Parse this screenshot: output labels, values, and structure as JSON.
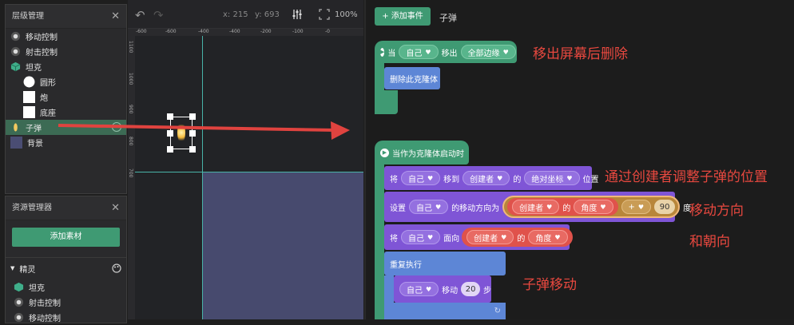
{
  "layer_panel": {
    "title": "层级管理",
    "close": "✕",
    "items": [
      {
        "label": "移动控制"
      },
      {
        "label": "射击控制"
      },
      {
        "label": "坦克"
      },
      {
        "label": "圆形"
      },
      {
        "label": "炮"
      },
      {
        "label": "底座"
      },
      {
        "label": "子弹"
      },
      {
        "label": "背景"
      }
    ]
  },
  "asset_panel": {
    "title": "资源管理器",
    "close": "✕",
    "add_label": "添加素材",
    "section": "精灵",
    "items": [
      {
        "label": "坦克"
      },
      {
        "label": "射击控制"
      },
      {
        "label": "移动控制"
      }
    ]
  },
  "toolbar": {
    "x_label": "x: 215",
    "y_label": "y: 693",
    "zoom": "100%"
  },
  "ruler": {
    "h": [
      "-600",
      "-600",
      "-400",
      "-400",
      "-200",
      "-100",
      "-0"
    ],
    "v": [
      "1100",
      "1000",
      "900",
      "800",
      "700"
    ]
  },
  "code": {
    "add_event": "+ 添加事件",
    "tab": "子弹",
    "b1": {
      "w1": "当",
      "p1": "自己",
      "w2": "移出",
      "p2": "全部边缘"
    },
    "b1_child": "删除此克隆体",
    "b2": {
      "hat": "当作为克隆体启动时"
    },
    "b3": {
      "w1": "将",
      "p1": "自己",
      "w2": "移到",
      "p2": "创建者",
      "w3": "的",
      "p3": "绝对坐标",
      "w4": "位置"
    },
    "b4": {
      "w1": "设置",
      "p1": "自己",
      "w2": "的移动方向为",
      "p2": "创建者",
      "w3": "的",
      "p3": "角度",
      "op": "+",
      "num": "90",
      "w4": "度"
    },
    "b5": {
      "w1": "将",
      "p1": "自己",
      "w2": "面向",
      "p2": "创建者",
      "w3": "的",
      "p3": "角度"
    },
    "b6": {
      "label": "重复执行"
    },
    "b7": {
      "p1": "自己",
      "w1": "移动",
      "num": "20",
      "w2": "步"
    }
  },
  "annotations": {
    "a1": "移出屏幕后删除",
    "a2": "通过创建者调整子弹的位置",
    "a3": "移动方向",
    "a4": "和朝向",
    "a5": "子弹移动"
  },
  "colors": {
    "accent": "#3f9a73",
    "purple": "#7f55d6",
    "blue": "#5d86d6",
    "event": "#3f9a73",
    "red_pill": "#e0524b",
    "arrow": "#e0433f"
  }
}
